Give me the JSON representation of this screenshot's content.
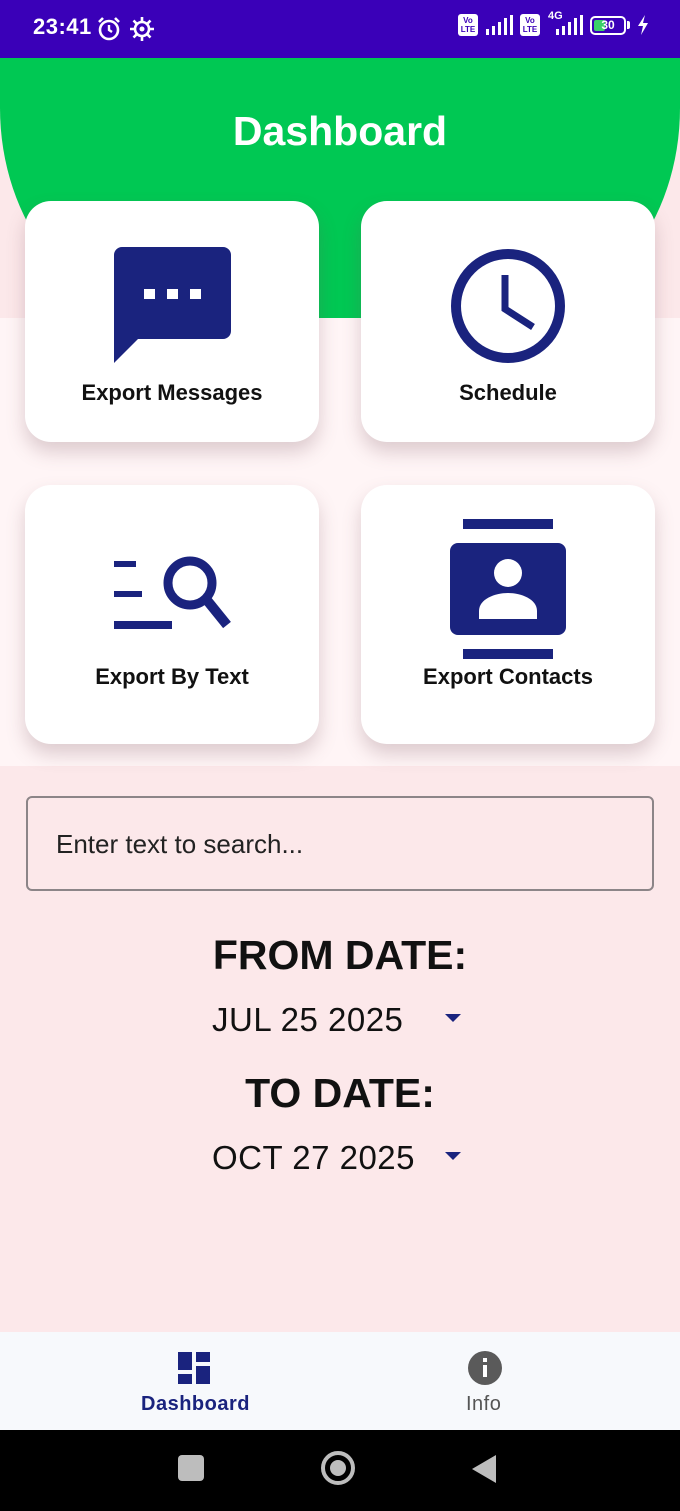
{
  "status_bar": {
    "time": "23:41",
    "battery": "30",
    "volte1": "Vo LTE",
    "volte2": "Vo LTE",
    "network": "4G",
    "icons": [
      "alarm-icon",
      "settings-icon",
      "signal-icon",
      "charging-icon"
    ]
  },
  "header": {
    "title": "Dashboard"
  },
  "cards": [
    {
      "label": "Export Messages",
      "icon": "message-icon"
    },
    {
      "label": "Schedule",
      "icon": "clock-icon"
    },
    {
      "label": "Export By Text",
      "icon": "text-search-icon"
    },
    {
      "label": "Export Contacts",
      "icon": "contacts-icon"
    }
  ],
  "search": {
    "placeholder": "Enter text to search..."
  },
  "from_date": {
    "title": "FROM DATE:",
    "value": "JUL 25 2025"
  },
  "to_date": {
    "title": "TO DATE:",
    "value": "OCT 27 2025"
  },
  "bottom_nav": {
    "items": [
      {
        "label": "Dashboard",
        "icon": "dashboard-icon",
        "active": true
      },
      {
        "label": "Info",
        "icon": "info-icon",
        "active": false
      }
    ]
  },
  "colors": {
    "header": "#00c853",
    "status_bar": "#3a00b8",
    "icon_navy": "#1a237e",
    "background": "#fce8ea"
  }
}
